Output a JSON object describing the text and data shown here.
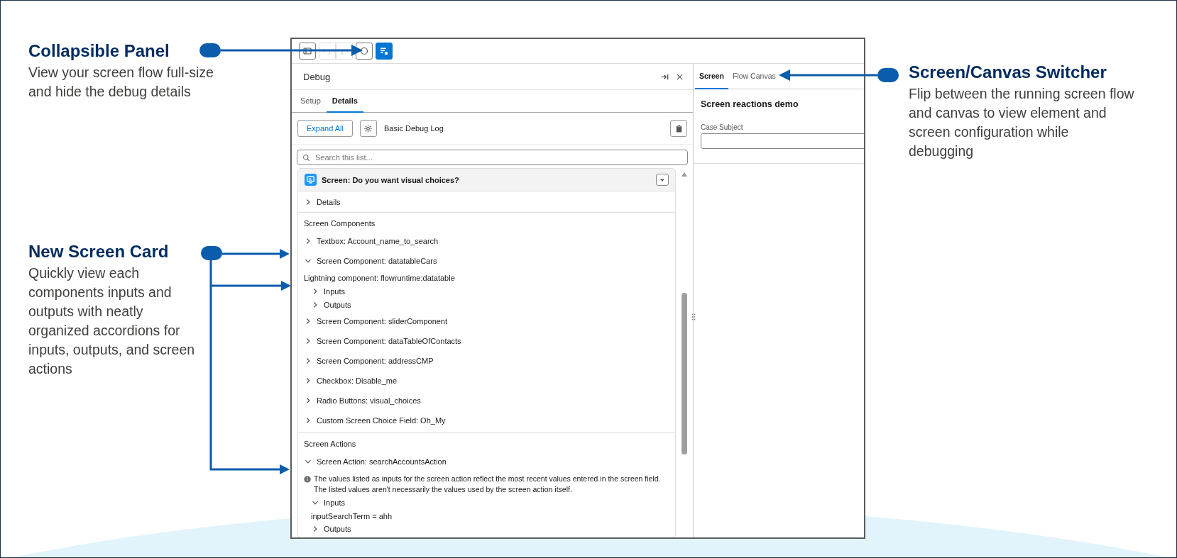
{
  "callouts": [
    {
      "title": "Collapsible Panel",
      "text": "View your screen flow full-size and hide the debug details"
    },
    {
      "title": "New Screen Card",
      "text": "Quickly view each components inputs and outputs with neatly organized accordions for inputs, outputs, and screen actions"
    },
    {
      "title": "Screen/Canvas Switcher",
      "text": "Flip between the running screen flow and canvas to view element and screen configuration while debugging"
    }
  ],
  "toolbar": {
    "buttons": [
      {
        "kind": "layout",
        "on": false,
        "disabled": false
      },
      {
        "kind": "undo",
        "on": false,
        "disabled": true
      },
      {
        "kind": "redo",
        "on": false,
        "disabled": true
      },
      {
        "kind": "round",
        "on": false,
        "disabled": false
      },
      {
        "kind": "debug",
        "on": true,
        "disabled": false
      }
    ]
  },
  "debug_panel": {
    "title": "Debug",
    "tabs": [
      {
        "label": "Setup",
        "selected": false
      },
      {
        "label": "Details",
        "selected": true
      }
    ],
    "expand_button": "Expand All",
    "log_level": "Basic Debug Log",
    "search": {
      "placeholder": "Search this list..."
    },
    "card": {
      "title": "Screen: Do you want visual choices?",
      "details": {
        "label": "Details",
        "expanded": false
      },
      "sections": [
        {
          "heading": "Screen Components",
          "items": [
            {
              "label": "Textbox: Account_name_to_search",
              "expanded": false
            },
            {
              "label": "Screen Component: datatableCars",
              "expanded": true,
              "detail": "Lightning component: flowruntime:datatable",
              "children": [
                {
                  "label": "Inputs",
                  "expanded": false
                },
                {
                  "label": "Outputs",
                  "expanded": false
                }
              ]
            },
            {
              "label": "Screen Component: sliderComponent",
              "expanded": false
            },
            {
              "label": "Screen Component: dataTableOfContacts",
              "expanded": false
            },
            {
              "label": "Screen Component: addressCMP",
              "expanded": false
            },
            {
              "label": "Checkbox: Disable_me",
              "expanded": false
            },
            {
              "label": "Radio Buttons: visual_choices",
              "expanded": false
            },
            {
              "label": "Custom Screen Choice Field: Oh_My",
              "expanded": false
            }
          ]
        },
        {
          "heading": "Screen Actions",
          "items": [
            {
              "label": "Screen Action: searchAccountsAction",
              "expanded": true,
              "note": "The values listed as inputs for the screen action reflect the most recent values entered in the screen field. The listed values aren't necessarily the values used by the screen action itself.",
              "children": [
                {
                  "label": "Inputs",
                  "expanded": true,
                  "values": [
                    "inputSearchTerm = ahh"
                  ]
                },
                {
                  "label": "Outputs",
                  "expanded": false
                }
              ]
            }
          ]
        }
      ]
    }
  },
  "screen_panel": {
    "tabs": [
      {
        "label": "Screen",
        "selected": true
      },
      {
        "label": "Flow Canvas",
        "selected": false
      }
    ],
    "title": "Screen reactions demo",
    "field": {
      "label": "Case Subject"
    }
  }
}
